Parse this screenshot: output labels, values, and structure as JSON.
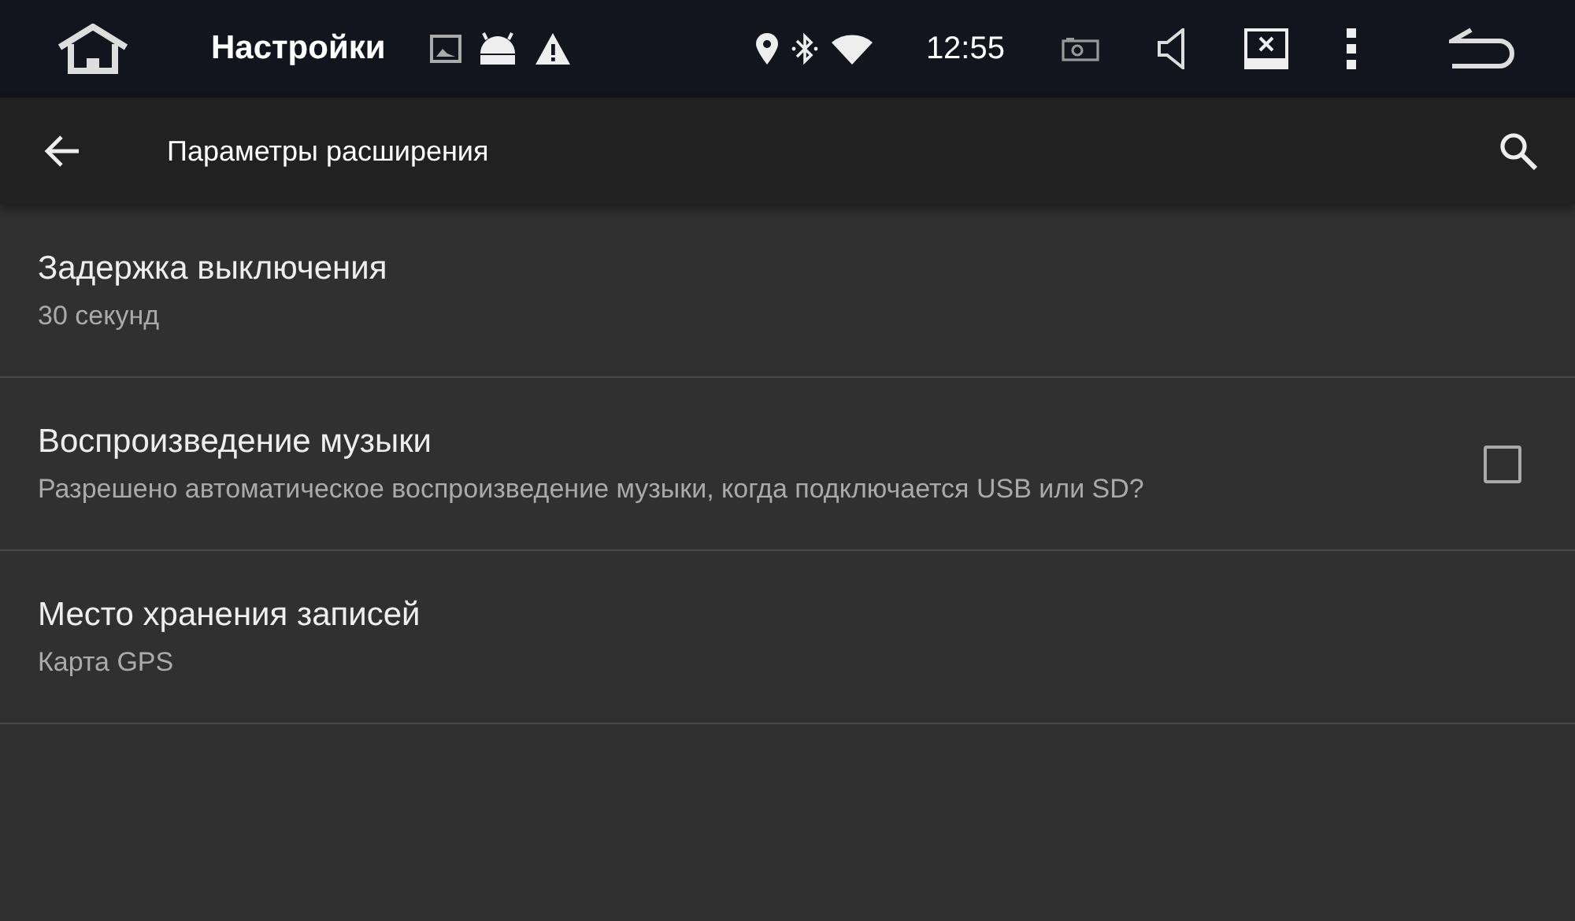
{
  "status_bar": {
    "title": "Настройки",
    "time": "12:55"
  },
  "toolbar": {
    "title": "Параметры расширения"
  },
  "settings": [
    {
      "kind": "text",
      "title": "Задержка выключения",
      "summary": "30 секунд"
    },
    {
      "kind": "checkbox",
      "title": "Воспроизведение музыки",
      "summary": "Разрешено автоматическое воспроизведение музыки, когда подключается USB или SD?",
      "checked": false
    },
    {
      "kind": "text",
      "title": "Место хранения записей",
      "summary": "Карта GPS"
    }
  ]
}
